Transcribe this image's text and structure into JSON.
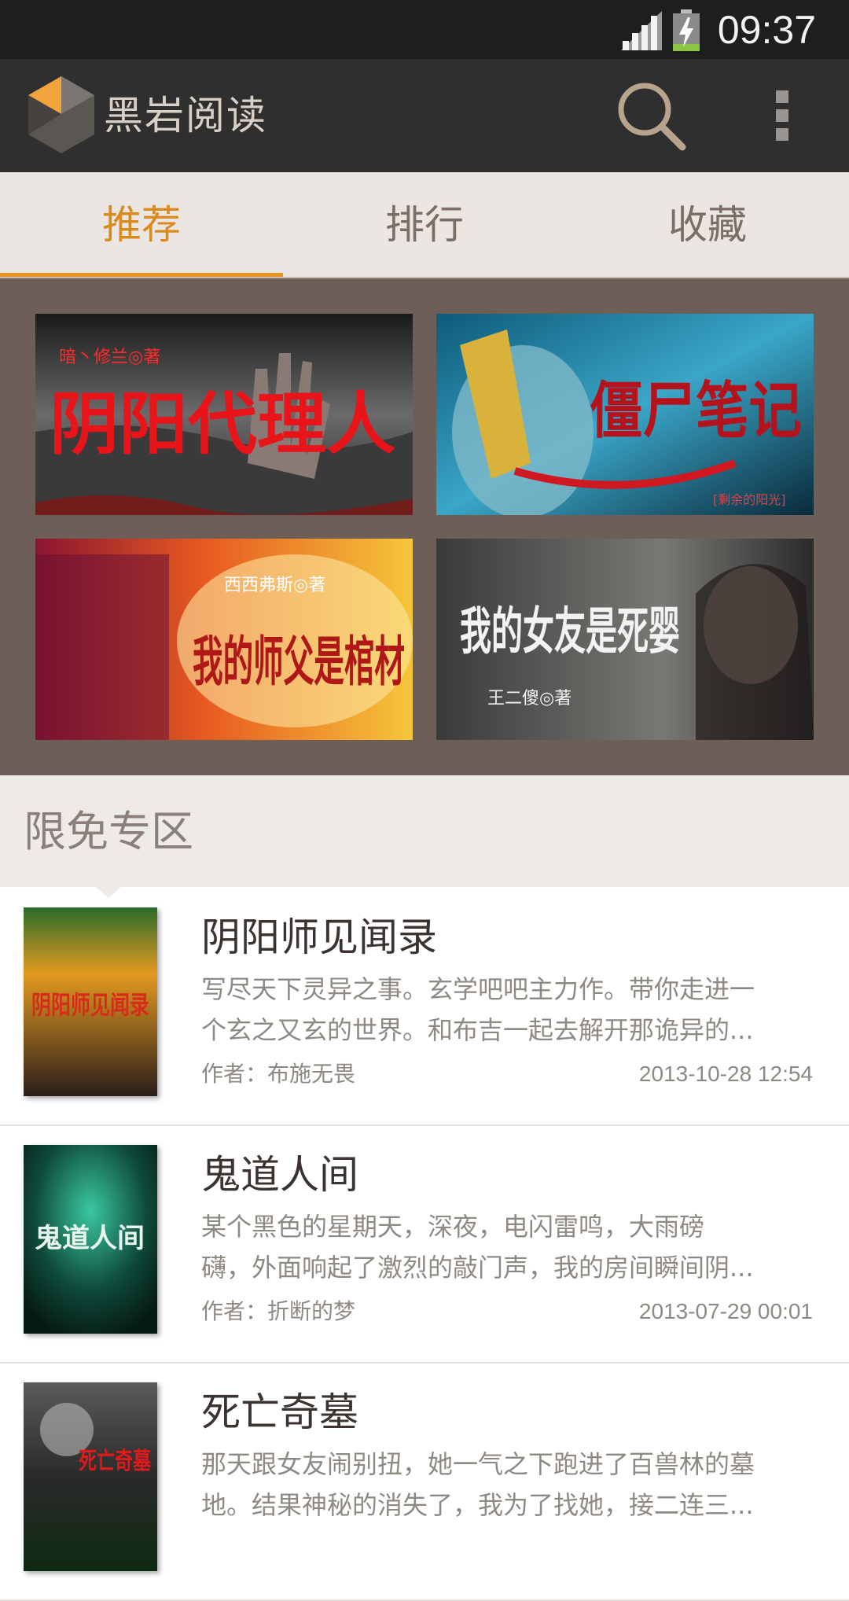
{
  "status_bar": {
    "time": "09:37"
  },
  "app_bar": {
    "title": "黑岩阅读",
    "logo_icon": "rock-logo-icon",
    "search_icon": "search-icon",
    "menu_icon": "overflow-menu-icon"
  },
  "tabs": [
    {
      "label": "推荐",
      "active": true
    },
    {
      "label": "排行",
      "active": false
    },
    {
      "label": "收藏",
      "active": false
    }
  ],
  "banners": [
    {
      "title": "阴阳代理人",
      "author": "暗丶修兰◎著"
    },
    {
      "title": "僵尸笔记",
      "author": "[剩余的阳光]"
    },
    {
      "title": "我的师父是棺材",
      "author": "西西弗斯◎著"
    },
    {
      "title": "我的女友是死婴",
      "author": "王二傻◎著"
    }
  ],
  "section": {
    "title": "限免专区"
  },
  "books": [
    {
      "title": "阴阳师见闻录",
      "desc_line1": "写尽天下灵异之事。玄学吧吧主力作。带你走进一",
      "desc_line2": "个玄之又玄的世界。和布吉一起去解开那诡异的...",
      "author": "作者：布施无畏",
      "date": "2013-10-28 12:54",
      "cover_text": "阴阳师见闻录"
    },
    {
      "title": "鬼道人间",
      "desc_line1": " 某个黑色的星期天，深夜，电闪雷鸣，大雨磅",
      "desc_line2": "礴，外面响起了激烈的敲门声，我的房间瞬间阴...",
      "author": "作者：折断的梦",
      "date": "2013-07-29 00:01",
      "cover_text": "鬼道人间"
    },
    {
      "title": "死亡奇墓",
      "desc_line1": " 那天跟女友闹别扭，她一气之下跑进了百兽林的墓",
      "desc_line2": "地。结果神秘的消失了，我为了找她，接二连三...",
      "author": "",
      "date": "",
      "cover_text": "死亡奇墓"
    }
  ],
  "colors": {
    "accent": "#e79420",
    "appbar": "#2f2f2f",
    "banner_bg": "#6d5f57"
  }
}
